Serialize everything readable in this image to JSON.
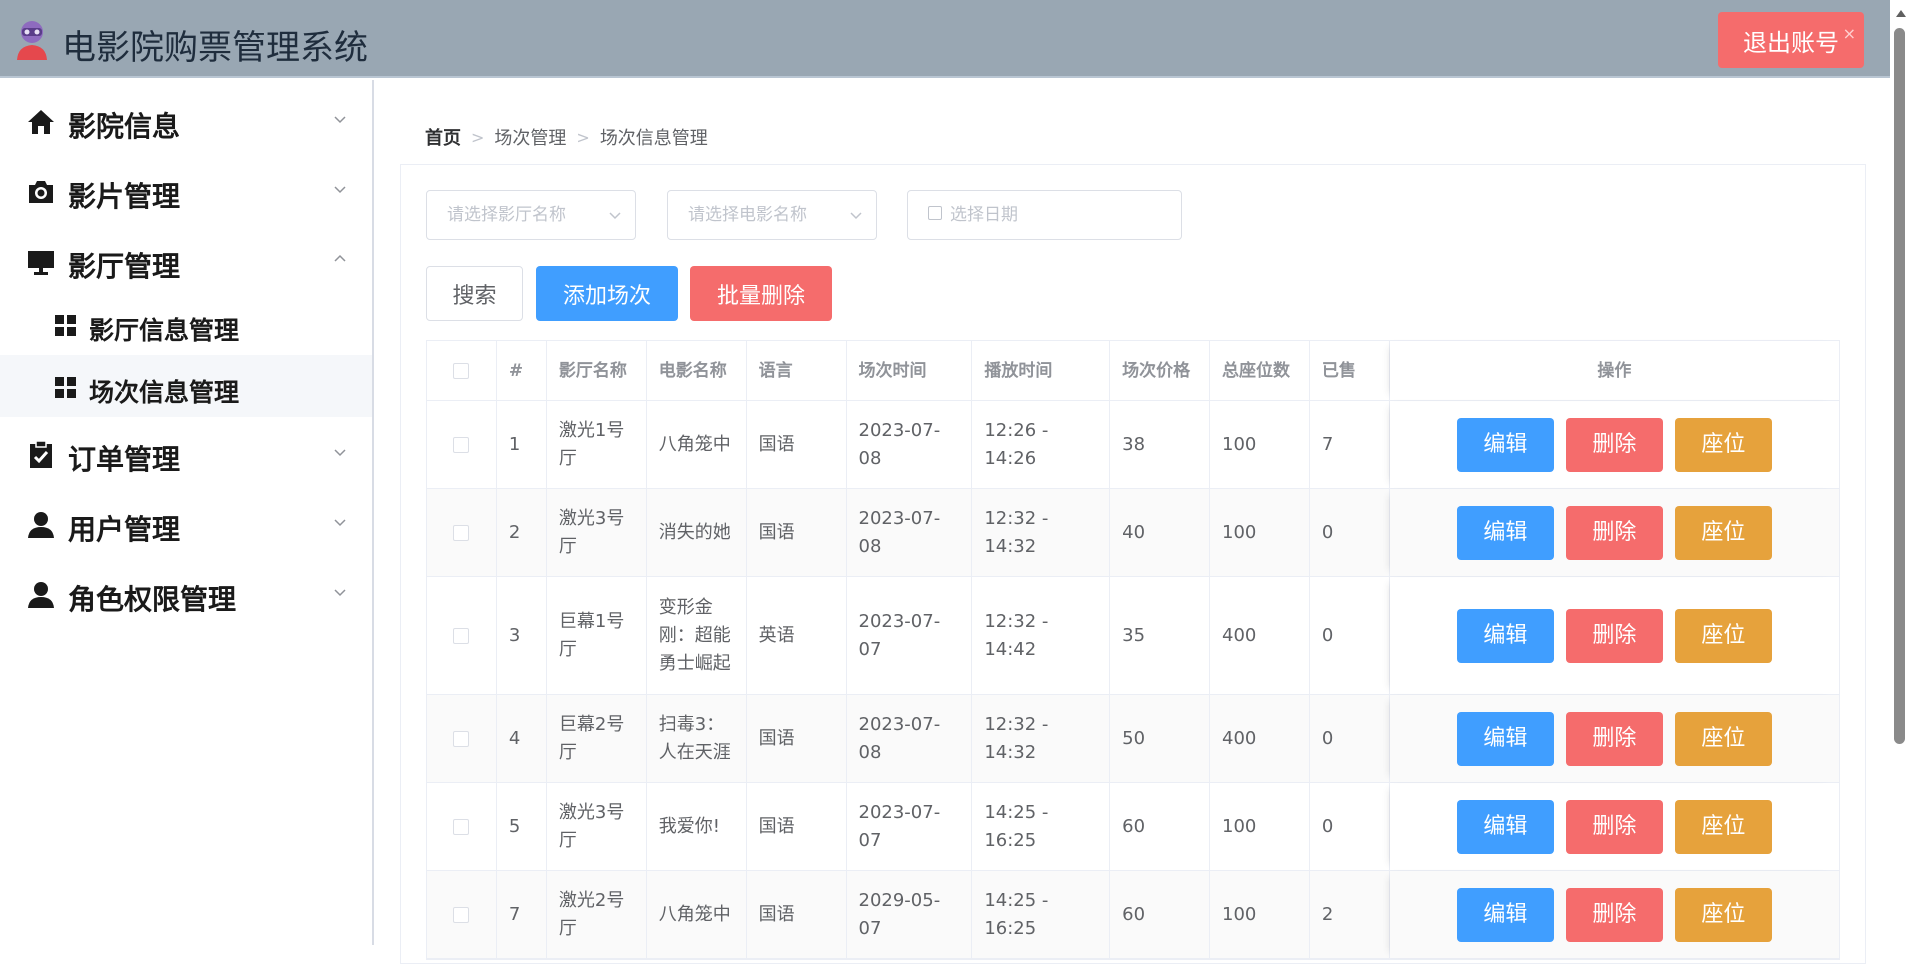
{
  "app": {
    "title": "电影院购票管理系统",
    "logout_label": "退出账号"
  },
  "sidebar": {
    "menus": [
      {
        "label": "影院信息",
        "icon": "home-icon"
      },
      {
        "label": "影片管理",
        "icon": "camera-icon"
      },
      {
        "label": "影厅管理",
        "icon": "monitor-icon"
      },
      {
        "label": "订单管理",
        "icon": "clipboard-check-icon"
      },
      {
        "label": "用户管理",
        "icon": "user-icon"
      },
      {
        "label": "角色权限管理",
        "icon": "user-icon"
      }
    ],
    "submenus": [
      {
        "label": "影厅信息管理",
        "icon": "grid-icon"
      },
      {
        "label": "场次信息管理",
        "icon": "grid-icon"
      }
    ]
  },
  "breadcrumb": {
    "home": "首页",
    "level1": "场次管理",
    "level2": "场次信息管理"
  },
  "filters": {
    "hall_placeholder": "请选择影厅名称",
    "movie_placeholder": "请选择电影名称",
    "date_placeholder": "选择日期"
  },
  "actions": {
    "search": "搜索",
    "add": "添加场次",
    "batch_delete": "批量删除"
  },
  "table": {
    "headers": {
      "index": "#",
      "hall": "影厅名称",
      "movie": "电影名称",
      "language": "语言",
      "date": "场次时间",
      "time": "播放时间",
      "price": "场次价格",
      "total_seats": "总座位数",
      "sold": "已售",
      "ops": "操作"
    },
    "op_labels": {
      "edit": "编辑",
      "delete": "删除",
      "seat": "座位"
    },
    "rows": [
      {
        "index": "1",
        "hall": "激光1号厅",
        "movie": "八角笼中",
        "language": "国语",
        "date": "2023-07-08",
        "time": "12:26 - 14:26",
        "price": "38",
        "total_seats": "100",
        "sold": "7"
      },
      {
        "index": "2",
        "hall": "激光3号厅",
        "movie": "消失的她",
        "language": "国语",
        "date": "2023-07-08",
        "time": "12:32 - 14:32",
        "price": "40",
        "total_seats": "100",
        "sold": "0"
      },
      {
        "index": "3",
        "hall": "巨幕1号厅",
        "movie": "变形金刚：超能勇士崛起",
        "language": "英语",
        "date": "2023-07-07",
        "time": "12:32 - 14:42",
        "price": "35",
        "total_seats": "400",
        "sold": "0"
      },
      {
        "index": "4",
        "hall": "巨幕2号厅",
        "movie": "扫毒3：人在天涯",
        "language": "国语",
        "date": "2023-07-08",
        "time": "12:32 - 14:32",
        "price": "50",
        "total_seats": "400",
        "sold": "0"
      },
      {
        "index": "5",
        "hall": "激光3号厅",
        "movie": "我爱你!",
        "language": "国语",
        "date": "2023-07-07",
        "time": "14:25 - 16:25",
        "price": "60",
        "total_seats": "100",
        "sold": "0"
      },
      {
        "index": "7",
        "hall": "激光2号厅",
        "movie": "八角笼中",
        "language": "国语",
        "date": "2029-05-07",
        "time": "14:25 - 16:25",
        "price": "60",
        "total_seats": "100",
        "sold": "2"
      }
    ]
  }
}
